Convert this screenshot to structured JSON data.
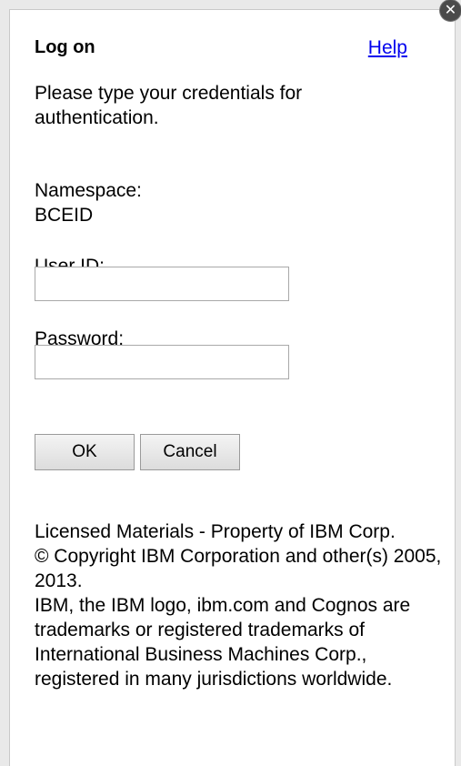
{
  "dialog": {
    "title": "Log on",
    "help_link": "Help",
    "close_icon": "close-icon",
    "instructions": "Please type your credentials for authentication.",
    "namespace": {
      "label": "Namespace:",
      "value": "BCEID"
    },
    "user_id": {
      "label": "User ID:",
      "value": "",
      "placeholder": ""
    },
    "password": {
      "label": "Password:",
      "value": "",
      "placeholder": ""
    },
    "buttons": {
      "ok": "OK",
      "cancel": "Cancel"
    },
    "legal": {
      "line1": "Licensed Materials - Property of IBM Corp.",
      "line2": "© Copyright IBM Corporation and other(s) 2005, 2013.",
      "line3": "IBM, the IBM logo, ibm.com and Cognos are trademarks or registered trademarks of International Business Machines Corp., registered in many jurisdictions worldwide."
    }
  }
}
